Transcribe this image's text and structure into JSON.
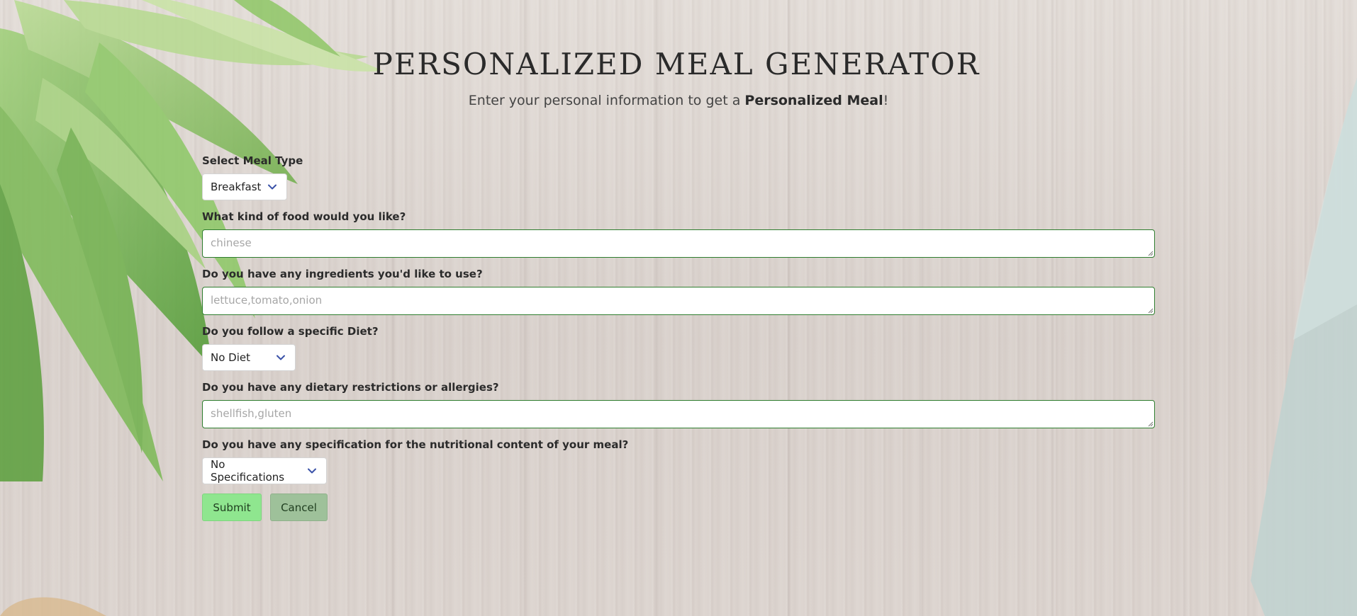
{
  "header": {
    "title": "PERSONALIZED MEAL GENERATOR",
    "subtitle_pre": "Enter your personal information to get a ",
    "subtitle_bold": "Personalized Meal",
    "subtitle_post": "!"
  },
  "form": {
    "meal_type": {
      "label": "Select Meal Type",
      "value": "Breakfast"
    },
    "food_kind": {
      "label": "What kind of food would you like?",
      "placeholder": "chinese"
    },
    "ingredients": {
      "label": "Do you have any ingredients you'd like to use?",
      "placeholder": "lettuce,tomato,onion"
    },
    "diet": {
      "label": "Do you follow a specific Diet?",
      "value": "No Diet"
    },
    "restrictions": {
      "label": "Do you have any dietary restrictions or allergies?",
      "placeholder": "shellfish,gluten"
    },
    "nutrition": {
      "label": "Do you have any specification for the nutritional content of your meal?",
      "value": "No Specifications"
    }
  },
  "buttons": {
    "submit": "Submit",
    "cancel": "Cancel"
  },
  "colors": {
    "input_border": "#2e7d2e",
    "submit_bg": "#8fe68f",
    "cancel_bg": "#9ec19a",
    "chevron": "#3a52a8"
  },
  "icons": {
    "select_chevron": "chevron-down-icon",
    "resize_grip": "resize-grip-icon"
  }
}
